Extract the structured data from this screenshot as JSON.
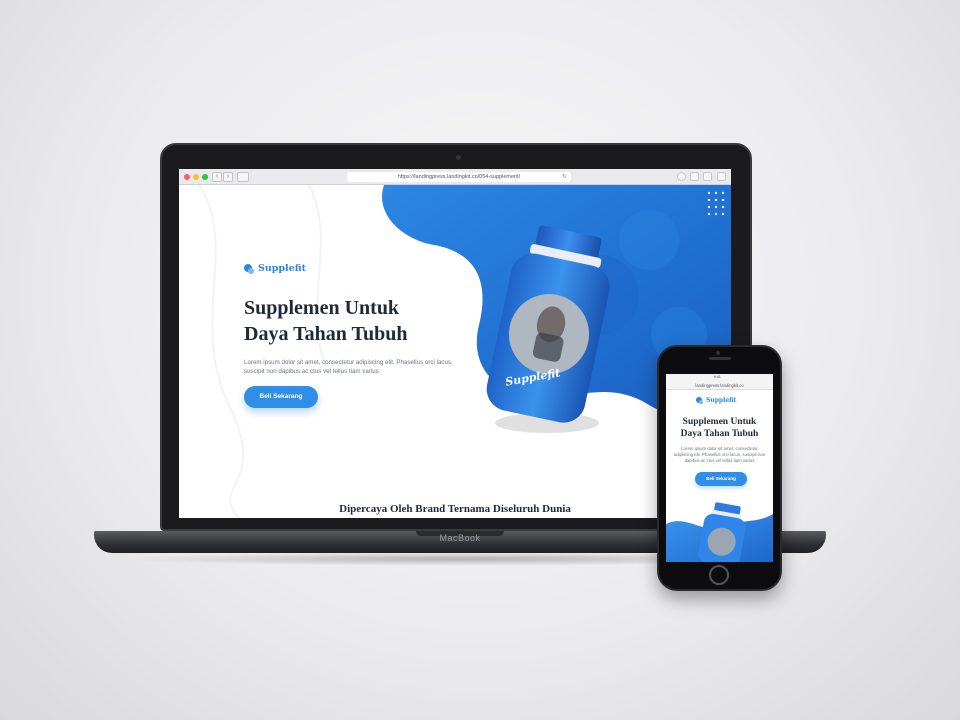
{
  "device_labels": {
    "laptop_brand": "MacBook"
  },
  "laptop": {
    "browser": {
      "url": "https://landingpress.landingkit.co/054-supplement/"
    },
    "page": {
      "brand_name": "Supplefit",
      "hero_title_line1": "Supplemen Untuk",
      "hero_title_line2": "Daya Tahan Tubuh",
      "hero_description": "Lorem ipsum dolor sit amet, consectetur adipiscing elit. Phasellus orci lacus, suscipit non dapibus ac ctus vel tellus tiam varius",
      "cta_label": "Beli Sekarang",
      "trusted_heading": "Dipercaya Oleh Brand Ternama Diseluruh Dunia",
      "product_label": "Supplefit"
    }
  },
  "phone": {
    "status_time": "9:41",
    "url": "landingpress.landingkit.co",
    "brand_name": "Supplefit",
    "hero_title_line1": "Supplemen Untuk",
    "hero_title_line2": "Daya Tahan Tubuh",
    "hero_description": "Lorem ipsum dolor sit amet, consectetur adipiscing elit. Phasellus orci lacus, suscipit non dapibus ac ctus vel tellus tiam varius",
    "cta_label": "Beli Sekarang"
  },
  "colors": {
    "brand_blue": "#2b86e6",
    "cta_blue": "#2f8fe8",
    "hero_blue": "#1f6fd1",
    "heading_dark": "#1f2a37",
    "body_gray": "#6b7280"
  }
}
